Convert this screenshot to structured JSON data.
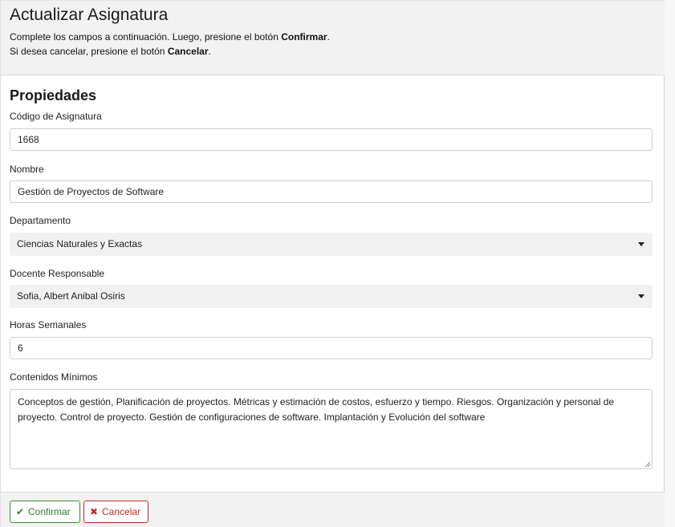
{
  "header": {
    "title": "Actualizar Asignatura",
    "line1_prefix": "Complete los campos a continuación. Luego, presione el botón ",
    "line1_bold": "Confirmar",
    "line1_suffix": ".",
    "line2_prefix": "Si desea cancelar, presione el botón ",
    "line2_bold": "Cancelar",
    "line2_suffix": "."
  },
  "form": {
    "section_title": "Propiedades",
    "codigo": {
      "label": "Código de Asignatura",
      "value": "1668"
    },
    "nombre": {
      "label": "Nombre",
      "value": "Gestión de Proyectos de Software"
    },
    "departamento": {
      "label": "Departamento",
      "value": "Ciencias Naturales y Exactas"
    },
    "docente": {
      "label": "Docente Responsable",
      "value": "Sofia, Albert Anibal Osiris"
    },
    "horas": {
      "label": "Horas Semanales",
      "value": "6"
    },
    "contenidos": {
      "label": "Contenidos Mínimos",
      "value": "Conceptos de gestión, Planificación de proyectos. Métricas y estimación de costos, esfuerzo y tiempo. Riesgos. Organización y personal de proyecto. Control de proyecto. Gestión de configuraciones de software. Implantación y Evolución del software"
    }
  },
  "footer": {
    "confirm_label": "Confirmar",
    "confirm_icon": "check-icon",
    "cancel_label": "Cancelar",
    "cancel_icon": "times-icon"
  },
  "colors": {
    "confirm": "#2e7d32",
    "cancel": "#c62828",
    "header_bg": "#f2f2f2"
  }
}
